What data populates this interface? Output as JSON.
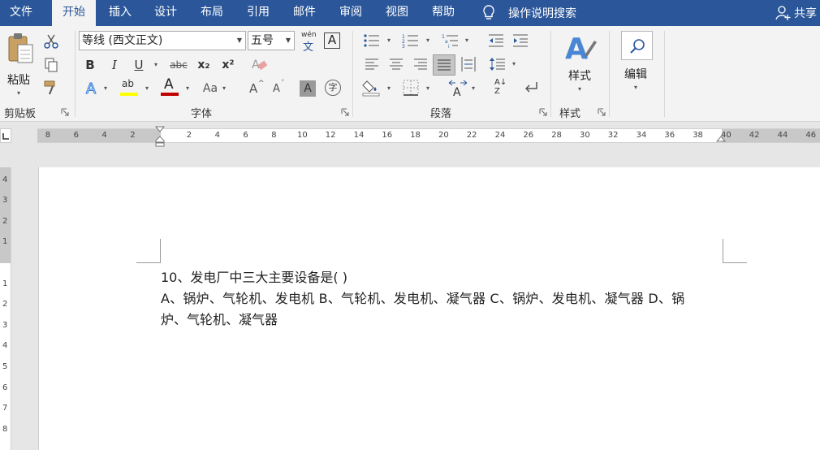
{
  "tabs": [
    {
      "label": "文件",
      "active": false
    },
    {
      "label": "开始",
      "active": true
    },
    {
      "label": "插入",
      "active": false
    },
    {
      "label": "设计",
      "active": false
    },
    {
      "label": "布局",
      "active": false
    },
    {
      "label": "引用",
      "active": false
    },
    {
      "label": "邮件",
      "active": false
    },
    {
      "label": "审阅",
      "active": false
    },
    {
      "label": "视图",
      "active": false
    },
    {
      "label": "帮助",
      "active": false
    }
  ],
  "tell_me": "操作说明搜索",
  "share": "共享",
  "clipboard": {
    "paste_label": "粘贴",
    "group_label": "剪贴板"
  },
  "font": {
    "font_name": "等线 (西文正文)",
    "font_size": "五号",
    "phonetic_glyph": "wén",
    "phonetic_char": "文",
    "border_char": "A",
    "bold": "B",
    "italic": "I",
    "underline": "U",
    "strike": "abc",
    "subscript": "x₂",
    "superscript": "x²",
    "effects": "A",
    "highlight": "ab",
    "font_color": "A",
    "change_case": "Aa",
    "grow": "A",
    "shrink": "A",
    "shading": "A",
    "enclose": "字",
    "group_label": "字体"
  },
  "paragraph": {
    "group_label": "段落",
    "sort_glyph": "A↓",
    "sort_glyph2": "Z"
  },
  "styles": {
    "label": "样式",
    "group_label": "样式"
  },
  "editing": {
    "label": "编辑"
  },
  "ruler": {
    "h_left_numbers": [
      "8",
      "6",
      "4",
      "2"
    ],
    "h_right_numbers": [
      "2",
      "4",
      "6",
      "8",
      "10",
      "12",
      "14",
      "16",
      "18",
      "20",
      "22",
      "24",
      "26",
      "28",
      "30",
      "32",
      "34",
      "36",
      "38",
      "40",
      "42",
      "44",
      "46"
    ],
    "v_top_numbers": [
      "4",
      "3",
      "2",
      "1"
    ],
    "v_numbers": [
      "1",
      "2",
      "3",
      "4",
      "5",
      "6",
      "7",
      "8"
    ]
  },
  "document": {
    "line1": "10、发电厂中三大主要设备是( )",
    "line2": "A、锅炉、气轮机、发电机 B、气轮机、发电机、凝气器 C、锅炉、发电机、凝气器 D、锅",
    "line3": "炉、气轮机、凝气器"
  },
  "colors": {
    "accent": "#2b579a",
    "highlight": "#ffff00",
    "font_color": "#c00000"
  }
}
